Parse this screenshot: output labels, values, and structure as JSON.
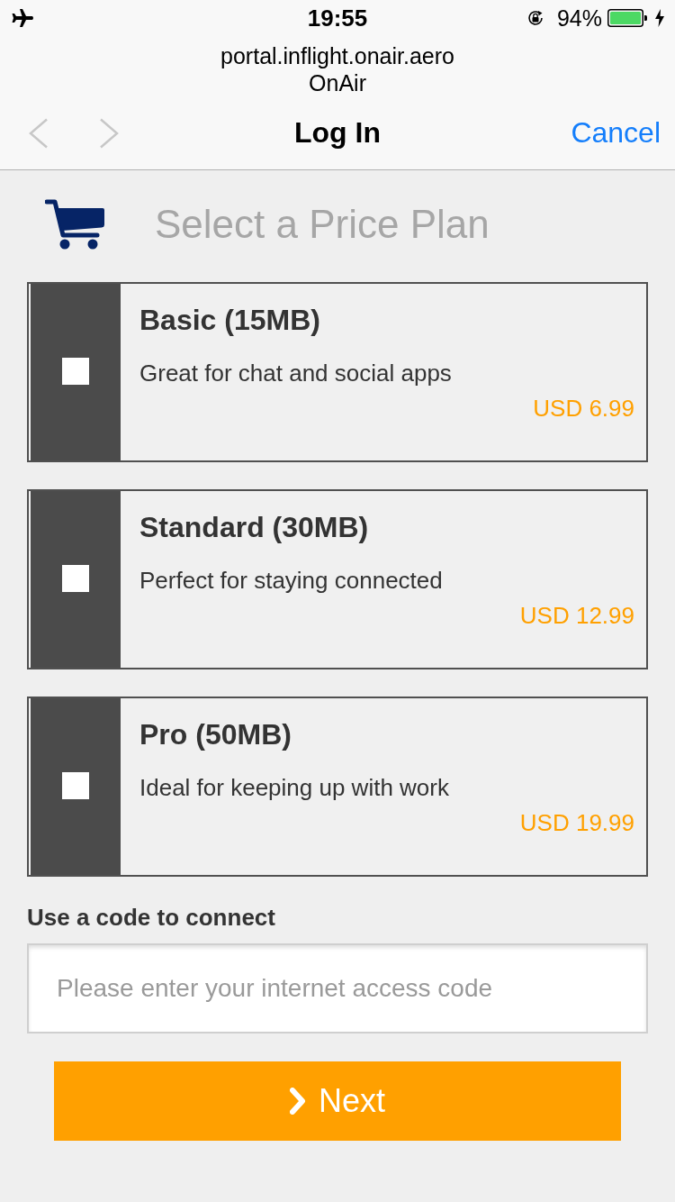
{
  "status_bar": {
    "time": "19:55",
    "battery_percent": "94%"
  },
  "browser_header": {
    "url": "portal.inflight.onair.aero",
    "site_name": "OnAir",
    "back": {
      "disabled": true
    },
    "forward": {
      "disabled": true
    },
    "title": "Log In",
    "cancel": "Cancel"
  },
  "page": {
    "title": "Select a Price Plan"
  },
  "plans": [
    {
      "name": "Basic (15MB)",
      "description": "Great for chat and social apps",
      "price": "USD 6.99",
      "checked": false
    },
    {
      "name": "Standard (30MB)",
      "description": "Perfect for staying connected",
      "price": "USD 12.99",
      "checked": false
    },
    {
      "name": "Pro (50MB)",
      "description": "Ideal for keeping up with work",
      "price": "USD 19.99",
      "checked": false
    }
  ],
  "code_section": {
    "label": "Use a code to connect",
    "placeholder": "Please enter your internet access code"
  },
  "next_button": {
    "label": "Next"
  }
}
